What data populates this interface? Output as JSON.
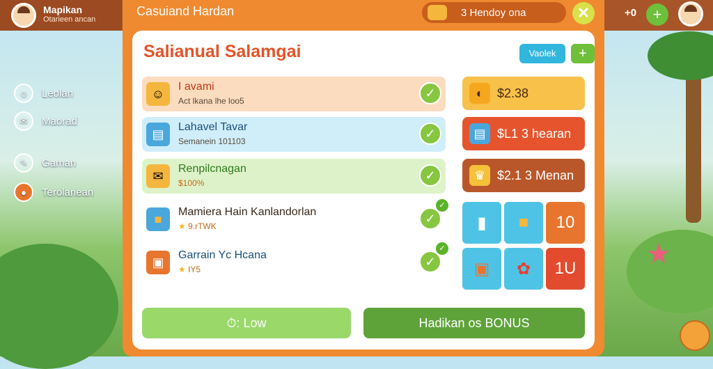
{
  "player": {
    "name": "Mapikan",
    "subtitle": "Otarieen ancan"
  },
  "sidebar": {
    "items": [
      {
        "label": "Leolan",
        "icon": "profile-icon"
      },
      {
        "label": "Maorad",
        "icon": "chat-icon"
      },
      {
        "label": "Gaman",
        "icon": "map-icon"
      },
      {
        "label": "Terolanean",
        "icon": "settings-icon"
      }
    ]
  },
  "topright": {
    "counter_label": "+0",
    "plus_label": "+"
  },
  "dialog": {
    "title": "Casuiand Hardan",
    "currency_label": "3 Hendoy ona",
    "close_label": "✕",
    "panel_title": "Salianual Salamgai",
    "view_button": "Vaolek",
    "add_button": "+"
  },
  "quests": [
    {
      "title": "I avami",
      "subtitle": "Act lkana lhe loo5",
      "bg": "#fbdcbf",
      "icon": "quest-scroll-icon"
    },
    {
      "title": "Lahavel Tavar",
      "subtitle": "Semanein 101103",
      "bg": "#cfeefa",
      "icon": "document-icon"
    },
    {
      "title": "Renpilcnagan",
      "subtitle": "$100%",
      "bg": "#def2c9",
      "icon": "ticket-icon"
    },
    {
      "title": "Mamiera Hain Kanlandorlan",
      "subtitle": "9.rTWK",
      "bg": "#ffffff",
      "icon": "gift-box-icon"
    },
    {
      "title": "Garrain Yc Hcana",
      "subtitle": "IY5",
      "bg": "#ffffff",
      "icon": "treasure-box-icon"
    }
  ],
  "offers": [
    {
      "label": "$2.38",
      "bg": "#f7c14a",
      "icon": "coin-bag-icon"
    },
    {
      "label": "$L1 3 hearan",
      "bg": "#e6542e",
      "icon": "chest-icon"
    },
    {
      "label": "$2.1 3 Menan",
      "bg": "#b9572a",
      "icon": "crown-icon"
    }
  ],
  "tiles": [
    {
      "label": "10",
      "bg": "#e8752e"
    },
    {
      "label": "1U",
      "bg": "#e34b2e"
    }
  ],
  "buttons": {
    "low": "⏱: Low",
    "bonus": "Hadikan os BONUS"
  }
}
